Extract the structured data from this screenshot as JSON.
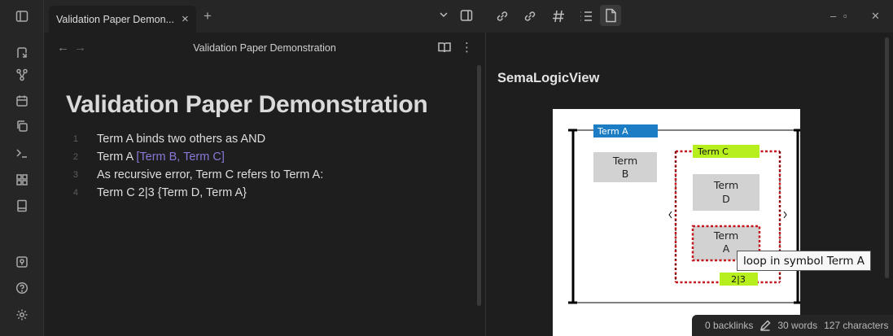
{
  "tab": {
    "title": "Validation Paper Demon...",
    "close": "×",
    "new": "+"
  },
  "editor": {
    "nav_title": "Validation Paper Demonstration",
    "doc_title": "Validation Paper Demonstration",
    "lines": [
      {
        "num": "1",
        "text": "Term A binds two others as AND"
      },
      {
        "num": "2",
        "pre": "Term A ",
        "link": "[Term B, Term C]"
      },
      {
        "num": "3",
        "text": "As recursive error, Term C refers to Term A:"
      },
      {
        "num": "4",
        "text": "Term C 2|3 {Term D, Term A}"
      }
    ]
  },
  "view": {
    "title": "SemaLogicView",
    "diagram": {
      "term_a_header": "Term A",
      "term_b": [
        "Term",
        "B"
      ],
      "term_c_header": "Term C",
      "term_d": [
        "Term",
        "D"
      ],
      "term_a_inner": [
        "Term",
        "A"
      ],
      "cardinality": "2|3",
      "colors": {
        "term_a_header": "#1c7cc4",
        "term_c_header": "#b7ef1e",
        "loop_border": "#c4161c",
        "box_fill": "#d2d2d2"
      }
    },
    "tooltip": "loop in symbol Term A"
  },
  "status": {
    "backlinks": "0 backlinks",
    "words": "30 words",
    "characters": "127 characters"
  },
  "icons": {
    "ribbon": [
      "sidebar-toggle-icon",
      "open-switcher-icon",
      "graph-view-icon",
      "calendar-icon",
      "copy-icon",
      "terminal-icon",
      "canvas-icon",
      "book-icon",
      "vault-icon",
      "help-icon",
      "settings-icon"
    ],
    "toolbar": [
      "outgoing-links-icon",
      "backlinks-icon",
      "tags-icon",
      "outline-icon",
      "file-icon"
    ]
  }
}
